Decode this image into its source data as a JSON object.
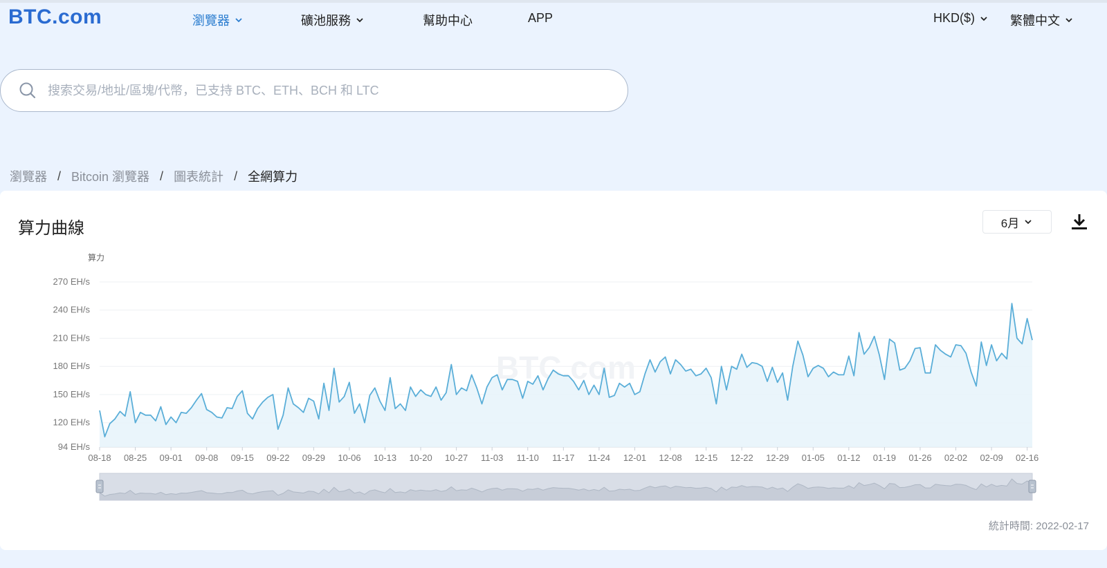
{
  "nav": {
    "logo": "BTC.com",
    "items": [
      {
        "label": "瀏覽器",
        "dropdown": true,
        "active": true
      },
      {
        "label": "礦池服務",
        "dropdown": true,
        "active": false
      },
      {
        "label": "幫助中心",
        "dropdown": false,
        "active": false
      },
      {
        "label": "APP",
        "dropdown": false,
        "active": false
      }
    ],
    "currency": "HKD($)",
    "language": "繁體中文"
  },
  "search": {
    "value": "",
    "placeholder": "搜索交易/地址/區塊/代幣，已支持 BTC、ETH、BCH 和 LTC"
  },
  "breadcrumb": [
    "瀏覽器",
    "Bitcoin 瀏覽器",
    "圖表統計",
    "全網算力"
  ],
  "breadcrumb_sep": "/",
  "card": {
    "title": "算力曲線",
    "period": "6月",
    "stat_time": "統計時間: 2022-02-17"
  },
  "colors": {
    "accent": "#2a7ccf",
    "line": "#5aaed8",
    "area": "#e6f3fa",
    "brand": "#2a6bd1"
  },
  "icons": {
    "search": "search-icon",
    "download": "download-icon",
    "dropdown": "chevron-down-icon",
    "slider_handle": "slider-handle-icon"
  },
  "chart_data": {
    "type": "area",
    "title": "",
    "xlabel": "",
    "ylabel": "算力",
    "unit": "EH/s",
    "watermark": "BTC.com",
    "ylim": [
      94,
      270
    ],
    "yticks": [
      94,
      120,
      150,
      180,
      210,
      240,
      270
    ],
    "ytick_labels": [
      "94 EH/s",
      "120 EH/s",
      "150 EH/s",
      "180 EH/s",
      "210 EH/s",
      "240 EH/s",
      "270 EH/s"
    ],
    "xtick_labels": [
      "08-18",
      "08-25",
      "09-01",
      "09-08",
      "09-15",
      "09-22",
      "09-29",
      "10-06",
      "10-13",
      "10-20",
      "10-27",
      "11-03",
      "11-10",
      "11-17",
      "11-24",
      "12-01",
      "12-08",
      "12-15",
      "12-22",
      "12-29",
      "01-05",
      "01-12",
      "01-19",
      "01-26",
      "02-02",
      "02-09",
      "02-16"
    ],
    "grid": true,
    "legend": "none",
    "series": [
      {
        "values": [
          133,
          105,
          119,
          124,
          132,
          127,
          153,
          120,
          131,
          128,
          128,
          122,
          137,
          118,
          126,
          120,
          131,
          130,
          136,
          144,
          151,
          134,
          131,
          126,
          125,
          136,
          135,
          148,
          154,
          130,
          124,
          135,
          142,
          147,
          150,
          113,
          128,
          157,
          140,
          136,
          131,
          146,
          143,
          124,
          162,
          133,
          178,
          142,
          148,
          163,
          130,
          140,
          120,
          149,
          157,
          143,
          133,
          168,
          135,
          140,
          133,
          158,
          148,
          155,
          150,
          148,
          158,
          144,
          152,
          182,
          150,
          157,
          154,
          171,
          157,
          140,
          158,
          168,
          171,
          155,
          166,
          166,
          164,
          146,
          164,
          161,
          170,
          155,
          167,
          176,
          172,
          170,
          170,
          164,
          155,
          165,
          150,
          160,
          150,
          178,
          147,
          149,
          162,
          158,
          162,
          150,
          153,
          172,
          187,
          174,
          185,
          190,
          172,
          187,
          182,
          175,
          177,
          170,
          172,
          178,
          168,
          140,
          180,
          155,
          180,
          177,
          193,
          179,
          184,
          183,
          180,
          164,
          179,
          163,
          173,
          144,
          180,
          207,
          192,
          169,
          178,
          181,
          178,
          169,
          174,
          171,
          171,
          191,
          170,
          216,
          193,
          200,
          212,
          192,
          166,
          209,
          205,
          176,
          178,
          186,
          199,
          200,
          173,
          173,
          203,
          197,
          193,
          190,
          203,
          202,
          194,
          174,
          159,
          206,
          181,
          203,
          186,
          194,
          188,
          247,
          210,
          204,
          231,
          208
        ]
      }
    ]
  }
}
